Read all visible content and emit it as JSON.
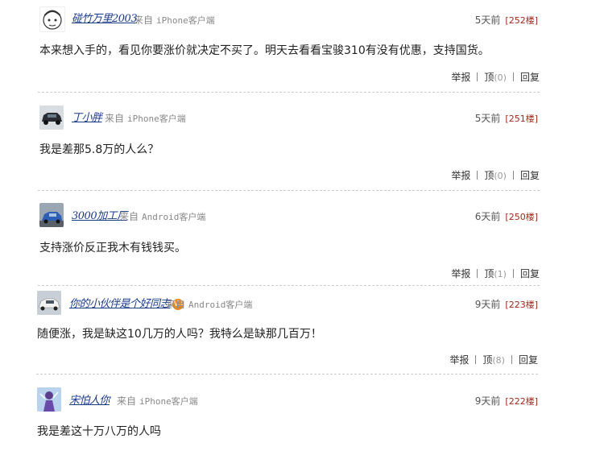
{
  "comments": [
    {
      "username": "碰竹万里2003",
      "from": "来自",
      "device": "iPhone客户端",
      "time": "5天前",
      "floor": "[252楼]",
      "content": "本来想入手的，看见你要涨价就决定不买了。明天去看看宝骏310有没有优惠，支持国货。",
      "report": "举报",
      "up": "顶",
      "up_count": "(0)",
      "reply": "回复",
      "avatar": "cartoon-face-avatar"
    },
    {
      "username": "丁小胖",
      "from": "来自",
      "device": "iPhone客户端",
      "time": "5天前",
      "floor": "[251楼]",
      "content": "我是差那5.8万的人么？",
      "report": "举报",
      "up": "顶",
      "up_count": "(0)",
      "reply": "回复",
      "avatar": "dark-suv-avatar"
    },
    {
      "username": "3000加工厂",
      "from": "来自",
      "device": "Android客户端",
      "time": "6天前",
      "floor": "[250楼]",
      "content": "支持涨价反正我木有钱钱买。",
      "report": "举报",
      "up": "顶",
      "up_count": "(1)",
      "reply": "回复",
      "avatar": "blue-car-avatar"
    },
    {
      "username": "你的小伙伴是个好同志",
      "badge": "V3",
      "from": "来自",
      "device": "Android客户端",
      "time": "9天前",
      "floor": "[223楼]",
      "content": "随便涨，我是缺这10几万的人吗？我特么是缺那几百万！",
      "report": "举报",
      "up": "顶",
      "up_count": "(8)",
      "reply": "回复",
      "avatar": "white-car-avatar"
    },
    {
      "username": "宋怕人你",
      "from": "来自",
      "device": "iPhone客户端",
      "time": "9天前",
      "floor": "[222楼]",
      "content": "我是差这十万八万的人吗",
      "avatar": "anime-figure-avatar"
    }
  ],
  "colors": {
    "username": "#1a3a8a",
    "floor": "#a0281a",
    "text": "#222222",
    "muted": "#888888"
  }
}
